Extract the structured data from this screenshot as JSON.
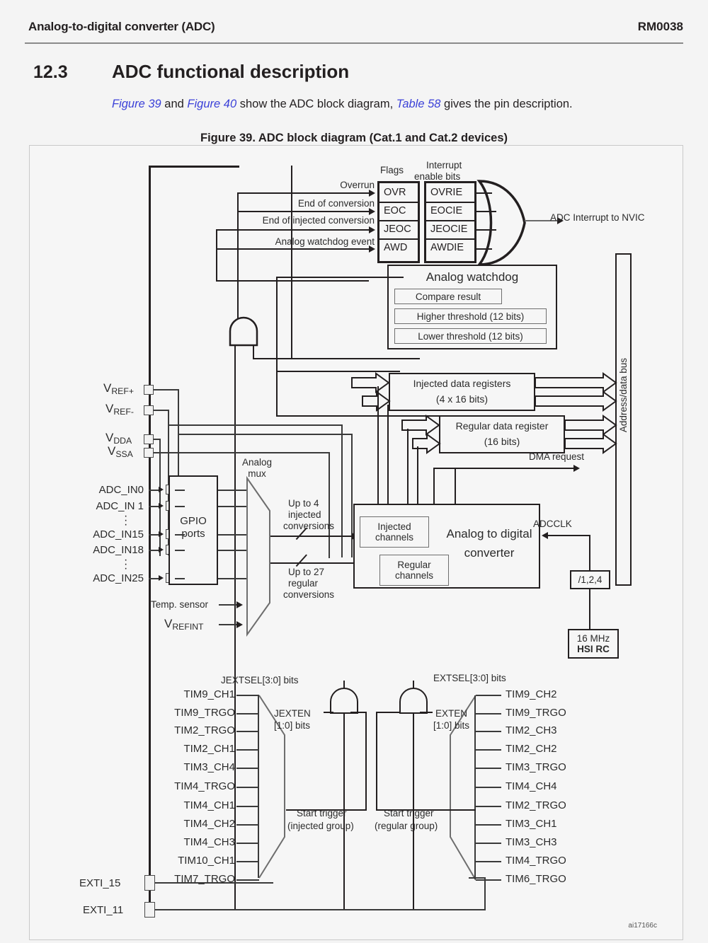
{
  "header": {
    "left_title": "Analog-to-digital converter (ADC)",
    "doc_id": "RM0038"
  },
  "section": {
    "number": "12.3",
    "title": "ADC functional description",
    "intro_parts": {
      "link1": "Figure 39",
      "text1": " and ",
      "link2": "Figure 40",
      "text2": " show the ADC block diagram, ",
      "link3": "Table 58",
      "text3": " gives the pin description."
    }
  },
  "figure": {
    "caption": "Figure 39. ADC block diagram (Cat.1 and Cat.2 devices)",
    "figure_id": "ai17166c"
  },
  "diagram": {
    "column_headers": {
      "flags": "Flags",
      "interrupt_enable": "Interrupt\nenable bits",
      "interrupt_enable_line1": "Interrupt",
      "interrupt_enable_line2": "enable bits"
    },
    "event_labels": [
      "Overrun",
      "End of conversion",
      "End of injected conversion",
      "Analog watchdog event"
    ],
    "flag_bits": [
      "OVR",
      "EOC",
      "JEOC",
      "AWD"
    ],
    "interrupt_enable_bits": [
      "OVRIE",
      "EOCIE",
      "JEOCIE",
      "AWDIE"
    ],
    "nvic_label": "ADC Interrupt to NVIC",
    "watchdog": {
      "title": "Analog watchdog",
      "rows": [
        "Compare result",
        "Higher threshold (12 bits)",
        "Lower threshold (12 bits)"
      ]
    },
    "injected_registers": {
      "line1": "Injected data registers",
      "line2": "(4 x 16 bits)"
    },
    "regular_register": {
      "line1": "Regular data register",
      "line2": "(16 bits)"
    },
    "bus_label": "Address/data bus",
    "dma_label": "DMA request",
    "supply_pins": [
      {
        "name": "V",
        "sub": "REF+"
      },
      {
        "name": "V",
        "sub": "REF-"
      },
      {
        "name": "V",
        "sub": "DDA"
      },
      {
        "name": "V",
        "sub": "SSA"
      }
    ],
    "adc_inputs": [
      "ADC_IN0",
      "ADC_IN 1",
      "ADC_IN15",
      "ADC_IN18",
      "ADC_IN25"
    ],
    "gpio_block": {
      "line1": "GPIO",
      "line2": "ports"
    },
    "analog_mux": {
      "line1": "Analog",
      "line2": "mux"
    },
    "mux_extra_inputs": [
      {
        "text": "Temp. sensor",
        "sub": ""
      },
      {
        "text": "V",
        "sub": "REFINT"
      }
    ],
    "conversion_labels": {
      "injected": {
        "l1": "Up to 4",
        "l2": "injected",
        "l3": "conversions"
      },
      "regular": {
        "l1": "Up to 27",
        "l2": "regular",
        "l3": "conversions"
      }
    },
    "channel_blocks": {
      "injected": {
        "line1": "Injected",
        "line2": "channels"
      },
      "regular": {
        "line1": "Regular",
        "line2": "channels"
      }
    },
    "converter": {
      "line1": "Analog to digital",
      "line2": "converter"
    },
    "clock": {
      "adcclk_label": "ADCCLK",
      "prescaler": "/1,2,4",
      "source_line1": "16 MHz",
      "source_line2": "HSI RC"
    },
    "injected_trigger": {
      "sel_bits_label": "JEXTSEL[3:0] bits",
      "enable_label_line1": "JEXTEN",
      "enable_label_line2": "[1:0] bits",
      "start_trigger_line1": "Start trigger",
      "start_trigger_line2": "(injected group)",
      "sources": [
        "TIM9_CH1",
        "TIM9_TRGO",
        "TIM2_TRGO",
        "TIM2_CH1",
        "TIM3_CH4",
        "TIM4_TRGO",
        "TIM4_CH1",
        "TIM4_CH2",
        "TIM4_CH3",
        "TIM10_CH1",
        "TIM7_TRGO"
      ]
    },
    "regular_trigger": {
      "sel_bits_label": "EXTSEL[3:0] bits",
      "enable_label_line1": "EXTEN",
      "enable_label_line2": "[1:0] bits",
      "start_trigger_line1": "Start trigger",
      "start_trigger_line2": "(regular group)",
      "sources": [
        "TIM9_CH2",
        "TIM9_TRGO",
        "TIM2_CH3",
        "TIM2_CH2",
        "TIM3_TRGO",
        "TIM4_CH4",
        "TIM2_TRGO",
        "TIM3_CH1",
        "TIM3_CH3",
        "TIM4_TRGO",
        "TIM6_TRGO"
      ]
    },
    "exti_pins": [
      "EXTI_15",
      "EXTI_11"
    ]
  },
  "colors": {
    "link": "#3b41d8",
    "ink": "#231f20",
    "page_bg": "#f4f4f4",
    "figure_bg": "#f6f6f6",
    "rule": "#8a8a8a"
  }
}
